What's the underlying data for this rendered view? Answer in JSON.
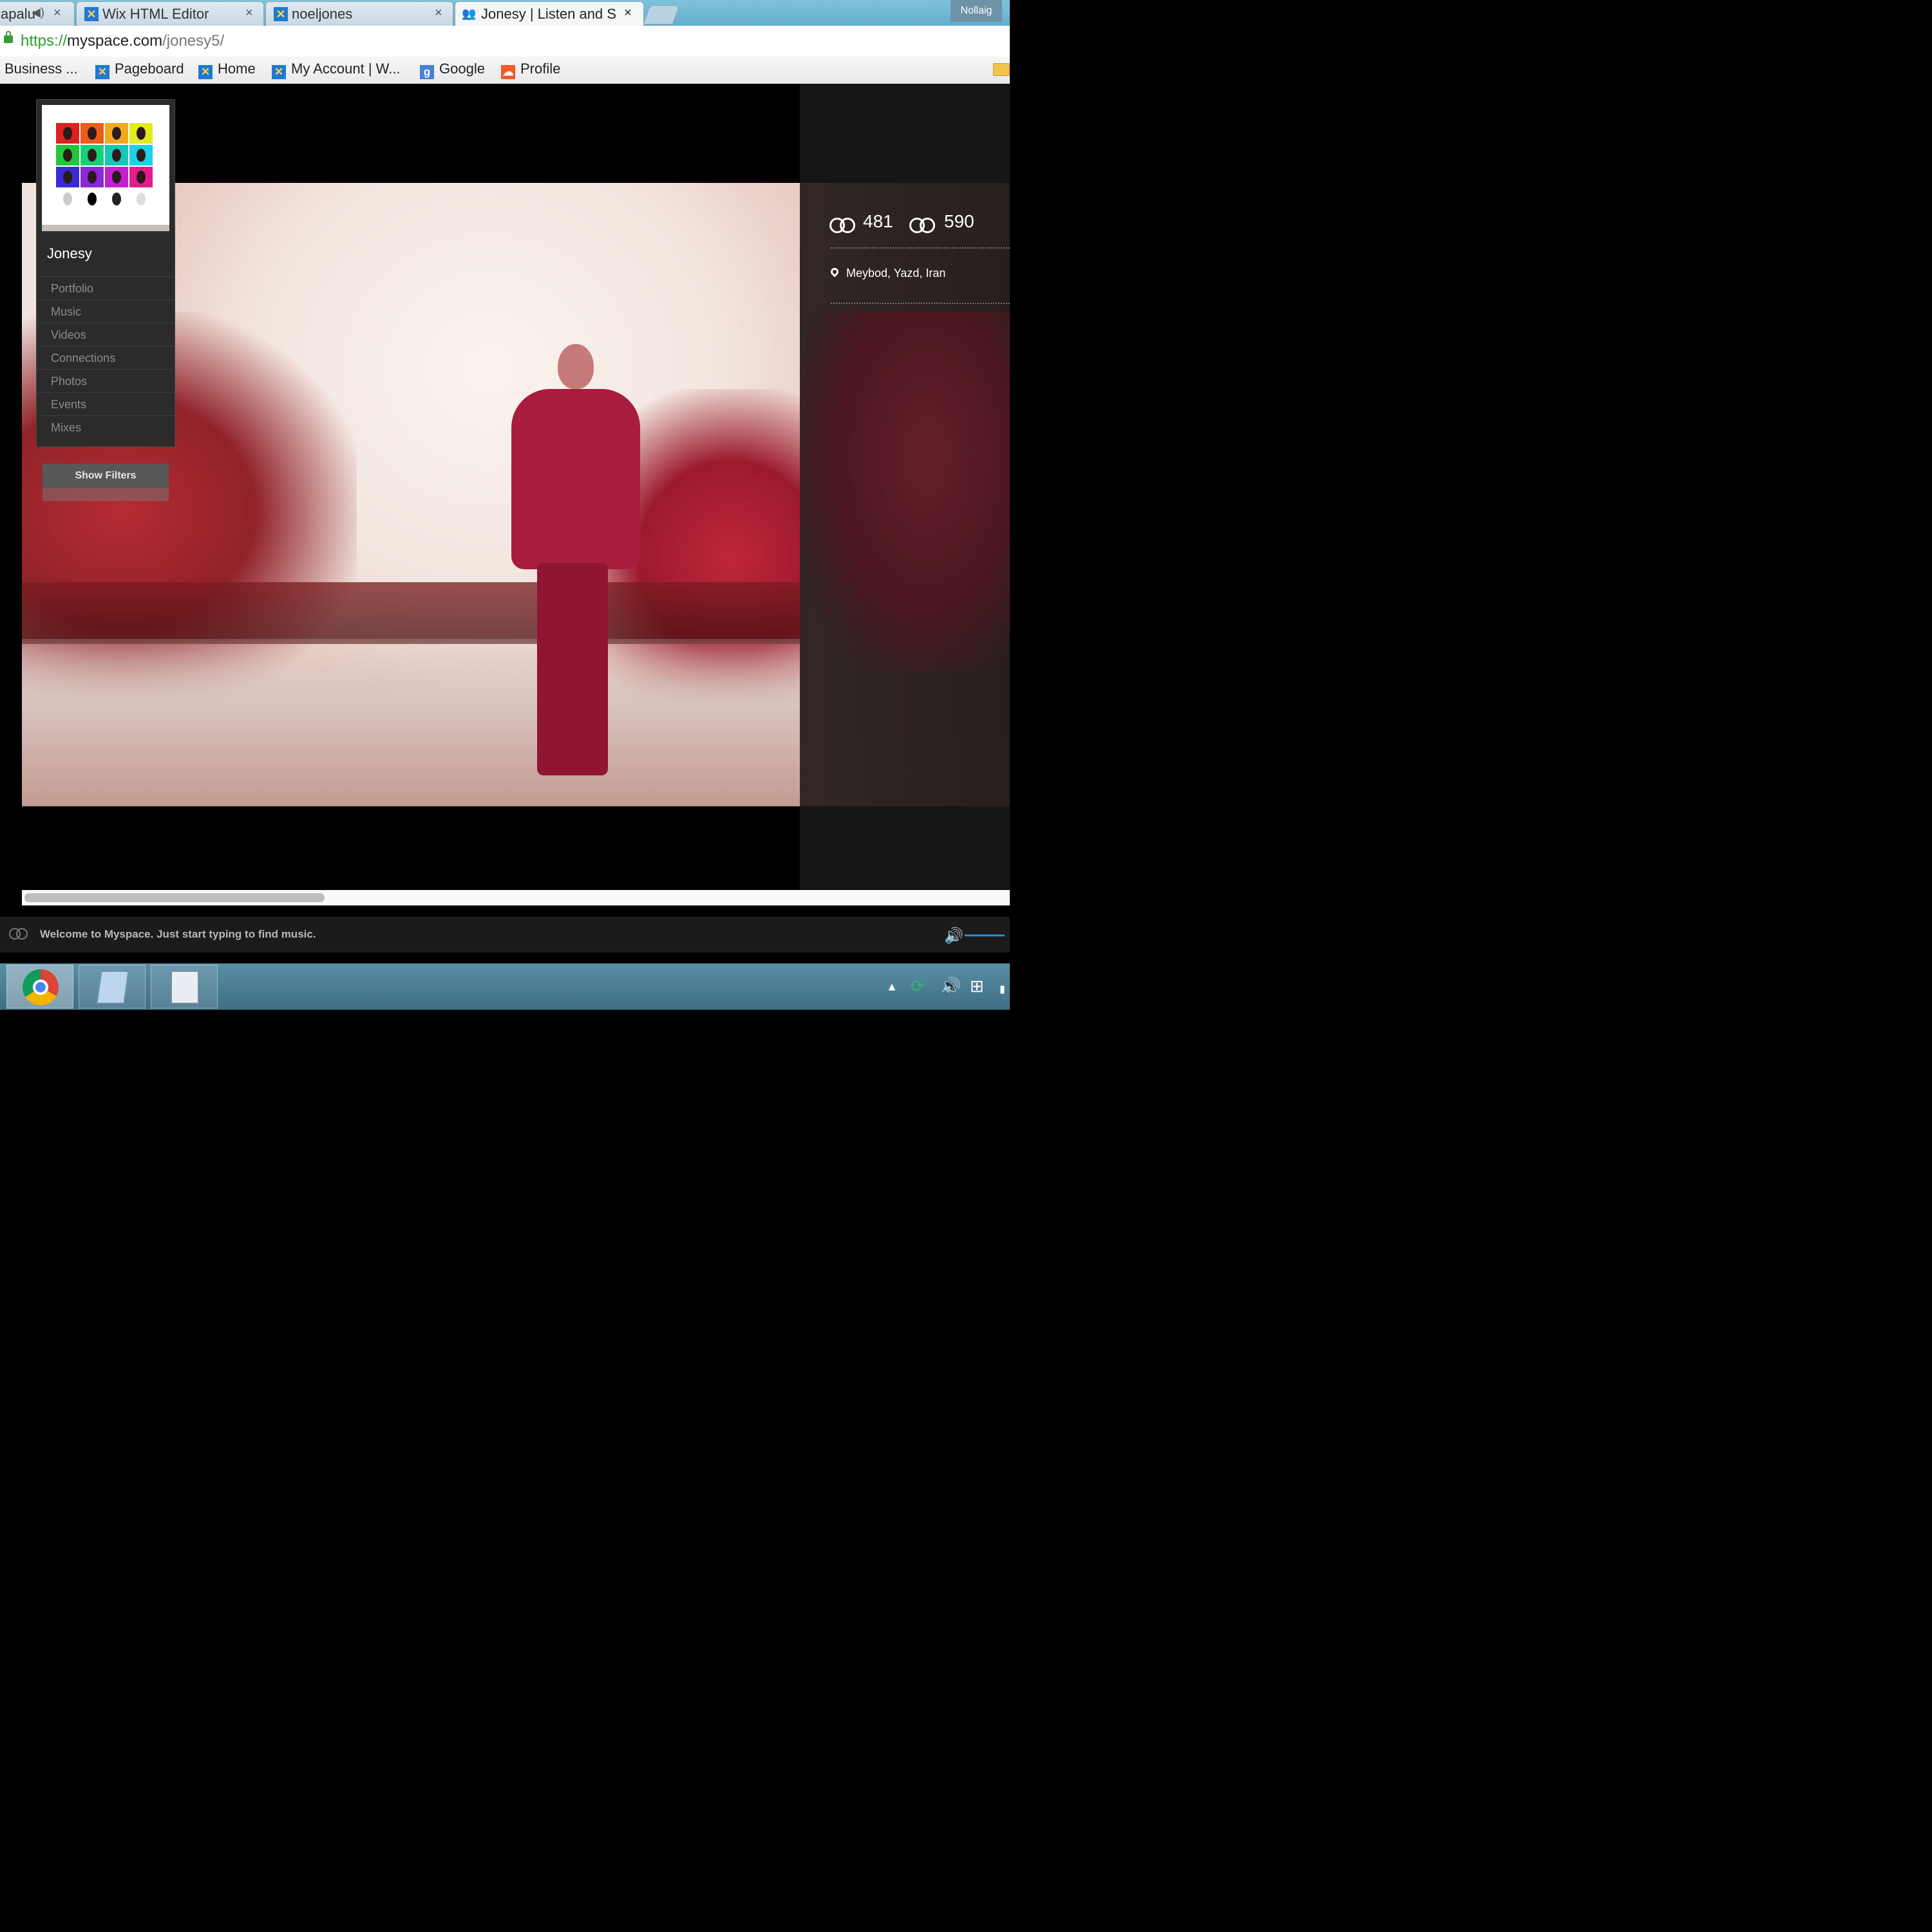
{
  "browser": {
    "tabs": [
      {
        "label": "apalu",
        "icon": "speaker-icon"
      },
      {
        "label": "Wix HTML Editor",
        "icon": "wix-icon"
      },
      {
        "label": "noeljones",
        "icon": "wix-icon"
      },
      {
        "label": "Jonesy | Listen and S",
        "icon": "myspace-people-icon"
      }
    ],
    "user": "Nollaig",
    "url": {
      "scheme": "https://",
      "host": "myspace.com",
      "path": "/jonesy5/"
    },
    "bookmarks": [
      {
        "label": "l Business ...",
        "icon": ""
      },
      {
        "label": "Pageboard",
        "icon": "wix"
      },
      {
        "label": "Home",
        "icon": "wix"
      },
      {
        "label": "My Account | W...",
        "icon": "wix"
      },
      {
        "label": "Google",
        "icon": "google"
      },
      {
        "label": "Profile",
        "icon": "soundcloud"
      }
    ]
  },
  "profile": {
    "name": "Jonesy",
    "nav": [
      "Portfolio",
      "Music",
      "Videos",
      "Connections",
      "Photos",
      "Events",
      "Mixes"
    ],
    "show_filters": "Show Filters",
    "connections_in": "481",
    "connections_out": "590",
    "location": "Meybod, Yazd, Iran"
  },
  "player": {
    "message": "Welcome to Myspace. Just start typing to find music."
  },
  "colors": {
    "accent": "#1e8fe0",
    "page_bg": "#000000",
    "panel_bg": "#2b2b2b"
  }
}
